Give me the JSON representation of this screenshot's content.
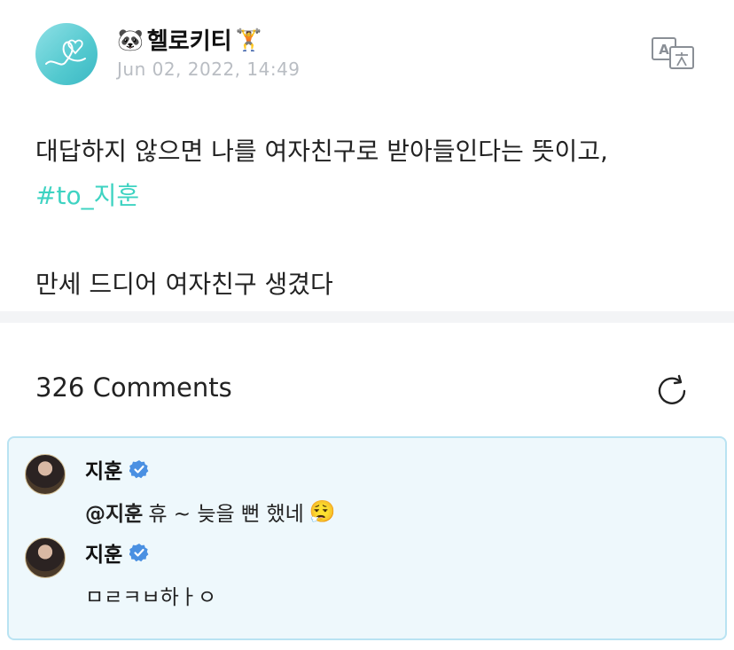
{
  "post": {
    "author": "헬로키티",
    "author_prefix_emoji": "🐼",
    "author_suffix_emoji": "🏋️",
    "date": "Jun 02, 2022, 14:49",
    "body_line1": "대답하지 않으면 나를 여자친구로 받아들인다는 뜻이고,",
    "hashtag": "#to_지훈",
    "body_line3": "만세 드디어 여자친구 생겼다",
    "translate_icon": "translate-icon"
  },
  "comments_section": {
    "count_label": "326 Comments",
    "refresh_icon": "refresh-icon"
  },
  "comments": [
    {
      "name": "지훈",
      "mention": "@지훈",
      "text": "휴 ~ 늦을 뻔 했네",
      "emoji": "😮‍💨",
      "verified": true
    },
    {
      "name": "지훈",
      "mention": "",
      "text": "ㅁㄹㅋㅂ하ㅏㅇ",
      "emoji": "",
      "verified": true
    }
  ],
  "colors": {
    "hashtag": "#3ed3c2",
    "verified": "#4a90e2",
    "comment_bg": "#eef8fc",
    "comment_border": "#b9e3f2"
  }
}
